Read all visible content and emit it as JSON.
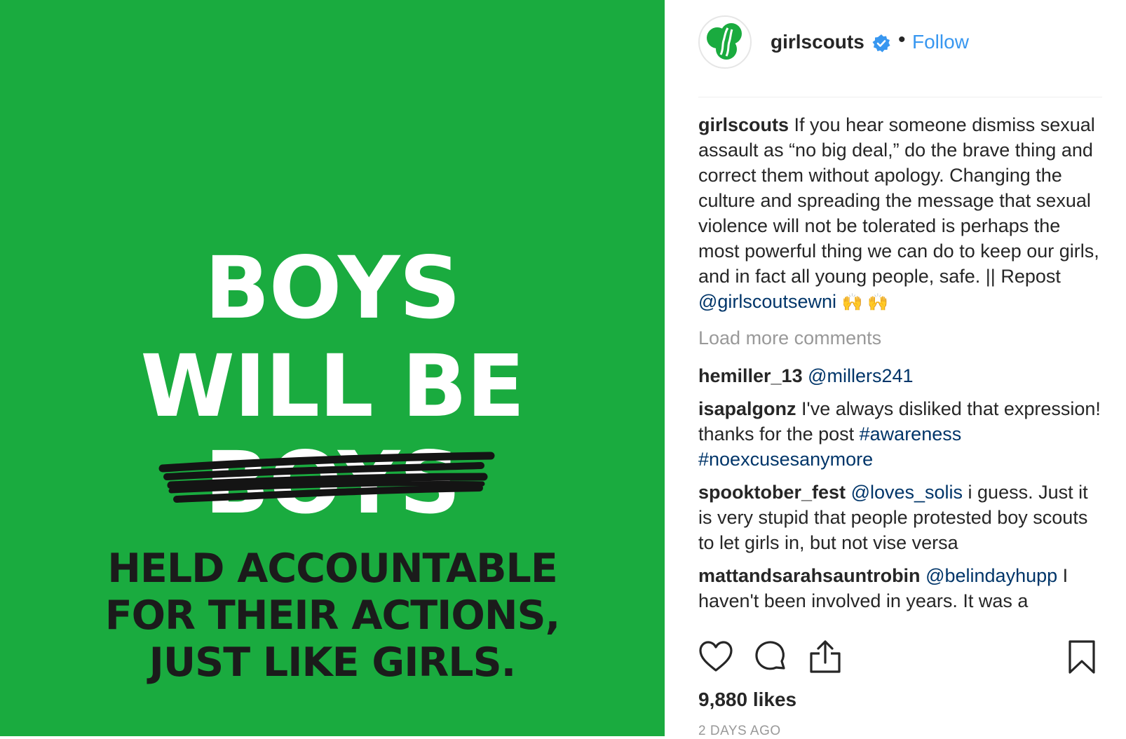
{
  "post_image": {
    "line1": "BOYS",
    "line2": "WILL BE",
    "line3_crossed": "BOYS",
    "line4": "HELD ACCOUNTABLE",
    "line5": "FOR THEIR ACTIONS,",
    "line6": "JUST LIKE GIRLS.",
    "background_color": "#1aab3f"
  },
  "header": {
    "username": "girlscouts",
    "verified_icon": "verified-badge-icon",
    "separator": "•",
    "follow_label": "Follow"
  },
  "caption": {
    "username": "girlscouts",
    "text": "If you hear someone dismiss sexual assault as “no big deal,” do the brave thing and correct them without apology. Changing the culture and spreading the message that sexual violence will not be tolerated is perhaps the most powerful thing we can do to keep our girls, and in fact all young people, safe. || Repost ",
    "mention": "@girlscoutsewni",
    "emoji": "🙌 🙌"
  },
  "load_more_label": "Load more comments",
  "comments": [
    {
      "username": "hemiller_13",
      "mention": "@millers241",
      "text": ""
    },
    {
      "username": "isapalgonz",
      "text": "I've always disliked that expression! thanks for the post ",
      "hashtags": [
        "#awareness",
        "#noexcusesanymore"
      ]
    },
    {
      "username": "spooktober_fest",
      "mention": "@loves_solis",
      "text": " i guess. Just it is very stupid that people protested boy scouts to let girls in, but not vise versa"
    },
    {
      "username": "mattandsarahsauntrobin",
      "mention": "@belindayhupp",
      "text": " I haven't been involved in years. It was a"
    }
  ],
  "actions": {
    "like_icon": "heart-icon",
    "comment_icon": "comment-icon",
    "share_icon": "share-icon",
    "save_icon": "bookmark-icon"
  },
  "likes_label": "9,880 likes",
  "timestamp": "2 DAYS AGO",
  "colors": {
    "link": "#003569",
    "follow": "#3897f0",
    "muted": "#999999"
  }
}
